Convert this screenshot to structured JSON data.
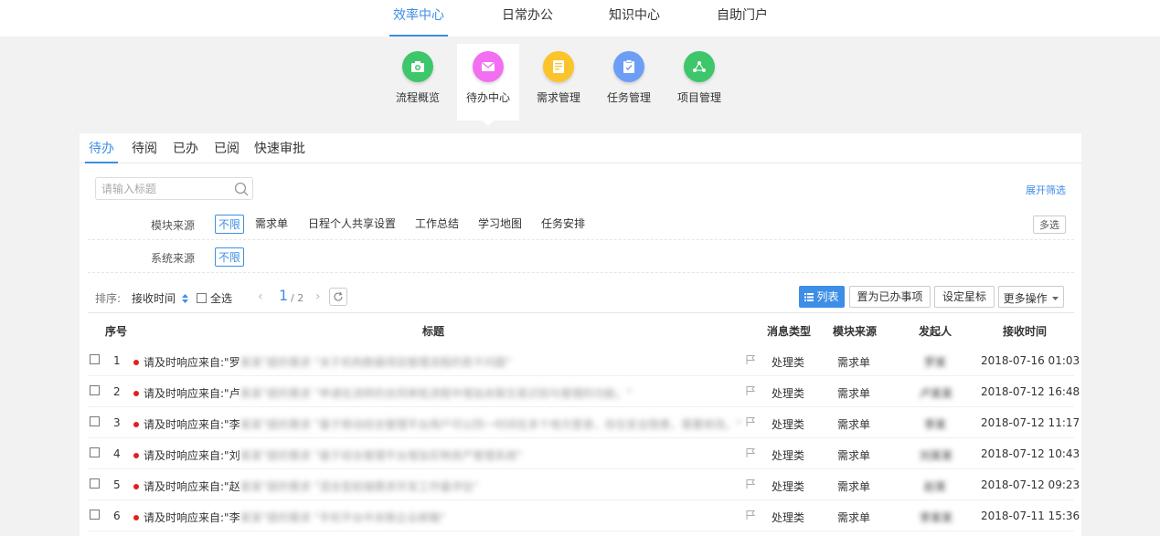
{
  "top_nav": [
    {
      "label": "效率中心",
      "active": true
    },
    {
      "label": "日常办公",
      "active": false
    },
    {
      "label": "知识中心",
      "active": false
    },
    {
      "label": "自助门户",
      "active": false
    }
  ],
  "apps": [
    {
      "label": "流程概览",
      "icon": "camera-icon",
      "color": "#3ec66a",
      "active": false
    },
    {
      "label": "待办中心",
      "icon": "mail-icon",
      "color": "#f26ff2",
      "active": true
    },
    {
      "label": "需求管理",
      "icon": "document-icon",
      "color": "#fbc42c",
      "active": false
    },
    {
      "label": "任务管理",
      "icon": "clipboard-icon",
      "color": "#6d9ef5",
      "active": false
    },
    {
      "label": "项目管理",
      "icon": "network-icon",
      "color": "#3ec66a",
      "active": false
    }
  ],
  "sub_tabs": [
    {
      "label": "待办",
      "active": true
    },
    {
      "label": "待阅",
      "active": false
    },
    {
      "label": "已办",
      "active": false
    },
    {
      "label": "已阅",
      "active": false
    },
    {
      "label": "快速审批",
      "active": false
    }
  ],
  "search": {
    "placeholder": "请输入标题"
  },
  "expand_filter": "展开筛选",
  "module_filter": {
    "label": "模块来源",
    "options": [
      "不限",
      "需求单",
      "日程个人共享设置",
      "工作总结",
      "学习地图",
      "任务安排"
    ],
    "selected": "不限",
    "multi_label": "多选"
  },
  "system_filter": {
    "label": "系统来源",
    "options": [
      "不限"
    ],
    "selected": "不限"
  },
  "toolbar": {
    "sort_label": "排序:",
    "sort_value": "接收时间",
    "select_all": "全选",
    "page_current": "1",
    "page_total": "/ 2",
    "list_btn": "列表",
    "mark_done_btn": "置为已办事项",
    "star_btn": "设定星标",
    "more_btn": "更多操作"
  },
  "table": {
    "headers": {
      "seq": "序号",
      "title": "标题",
      "msg_type": "消息类型",
      "module": "模块来源",
      "initiator": "发起人",
      "recv_time": "接收时间"
    },
    "rows": [
      {
        "seq": "1",
        "title_prefix": "请及时响应来自:\"罗",
        "title_blur": "某某\"提的需求 \"关于机构数据项目管理流程的若干问题\"",
        "msg_type": "处理类",
        "module": "需求单",
        "initiator": "罗某",
        "recv_time": "2018-07-16 01:03"
      },
      {
        "seq": "2",
        "title_prefix": "请及时响应来自:\"卢",
        "title_blur": "某某\"提的需求 \"申请在流转的合同审批流程中增加关联交易识别与管理的功能。\"",
        "msg_type": "处理类",
        "module": "需求单",
        "initiator": "卢某某",
        "recv_time": "2018-07-12 16:48"
      },
      {
        "seq": "3",
        "title_prefix": "请及时响应来自:\"李",
        "title_blur": "某某\"提的需求 \"基于移动综合管理平台用户可以同一时间在多个地方登录，存在安全隐患，需要修改。\"",
        "msg_type": "处理类",
        "module": "需求单",
        "initiator": "李某",
        "recv_time": "2018-07-12 11:17"
      },
      {
        "seq": "4",
        "title_prefix": "请及时响应来自:\"刘",
        "title_blur": "某某\"提的需求 \"基于综合管理平台增加实物资产管理系统\"",
        "msg_type": "处理类",
        "module": "需求单",
        "initiator": "刘某某",
        "recv_time": "2018-07-12 10:43"
      },
      {
        "seq": "5",
        "title_prefix": "请及时响应来自:\"赵",
        "title_blur": "某某\"提的需求 \"混合型前端需求开发工作量评估\"",
        "msg_type": "处理类",
        "module": "需求单",
        "initiator": "赵某",
        "recv_time": "2018-07-12 09:23"
      },
      {
        "seq": "6",
        "title_prefix": "请及时响应来自:\"李",
        "title_blur": "某某\"提的需求 \"手机平台中关联企业邮箱\"",
        "msg_type": "处理类",
        "module": "需求单",
        "initiator": "李某某",
        "recv_time": "2018-07-11 15:36"
      }
    ]
  },
  "colors": {
    "accent": "#3d8ee6",
    "unread_dot": "#e02020"
  }
}
